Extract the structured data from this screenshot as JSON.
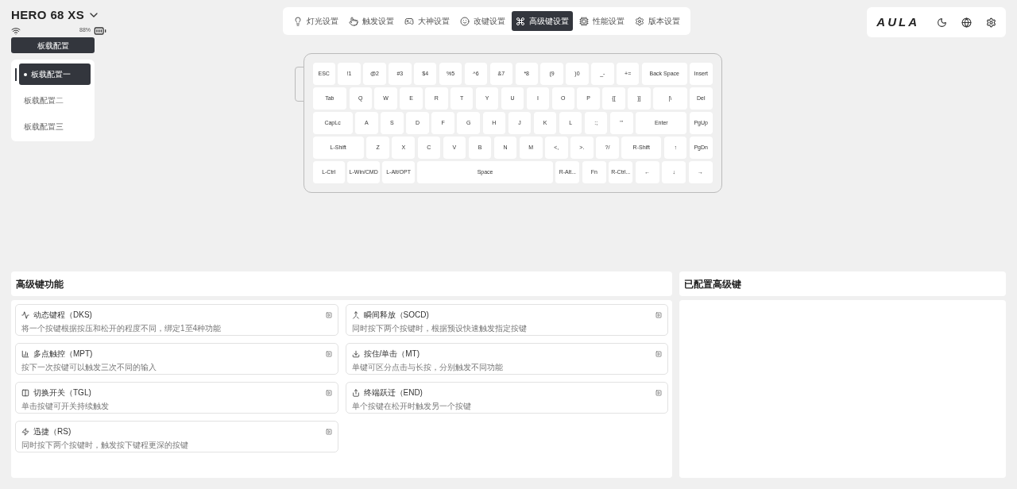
{
  "device": {
    "name": "HERO 68 XS",
    "battery": "88%"
  },
  "nav_tabs": [
    {
      "label": "灯光设置",
      "selected": false
    },
    {
      "label": "触发设置",
      "selected": false
    },
    {
      "label": "大神设置",
      "selected": false
    },
    {
      "label": "改键设置",
      "selected": false
    },
    {
      "label": "高级键设置",
      "selected": true
    },
    {
      "label": "性能设置",
      "selected": false
    },
    {
      "label": "版本设置",
      "selected": false
    }
  ],
  "brand": "AULA",
  "onboard": {
    "title": "板载配置",
    "profiles": [
      {
        "label": "板载配置一",
        "selected": true
      },
      {
        "label": "板载配置二",
        "selected": false
      },
      {
        "label": "板载配置三",
        "selected": false
      }
    ]
  },
  "keyboard": {
    "rows": [
      {
        "keys": [
          "ESC",
          "!1",
          "@2",
          "#3",
          "$4",
          "%5",
          "^6",
          "&7",
          "*8",
          "(9",
          ")0",
          "_-",
          "+=",
          "Back Space",
          "Insert"
        ]
      },
      {
        "keys": [
          "Tab",
          "Q",
          "W",
          "E",
          "R",
          "T",
          "Y",
          "U",
          "I",
          "O",
          "P",
          "{[",
          "}]",
          "|\\",
          "Del"
        ]
      },
      {
        "keys": [
          "CapLc",
          "A",
          "S",
          "D",
          "F",
          "G",
          "H",
          "J",
          "K",
          "L",
          ":;",
          "\"'",
          "Enter",
          "PgUp"
        ]
      },
      {
        "keys": [
          "L-Shift",
          "Z",
          "X",
          "C",
          "V",
          "B",
          "N",
          "M",
          "<,",
          ">.",
          "?/",
          "R-Shift",
          "↑",
          "PgDn"
        ]
      },
      {
        "keys": [
          "L-Ctrl",
          "L-Win/CMD",
          "L-Alt/OPT",
          "Space",
          "R-Alt...",
          "Fn",
          "R-Ctrl...",
          "←",
          "↓",
          "→"
        ]
      }
    ]
  },
  "advanced_functions": {
    "title": "高级键功能",
    "items": [
      {
        "title": "动态键程（DKS)",
        "description": "将一个按键根据按压和松开的程度不同，绑定1至4种功能"
      },
      {
        "title": "多点触控（MPT)",
        "description": "按下一次按键可以触发三次不同的输入"
      },
      {
        "title": "切换开关（TGL)",
        "description": "单击按键可开关持续触发"
      },
      {
        "title": "迅捷（RS)",
        "description": "同时按下两个按键时，触发按下键程更深的按键"
      },
      {
        "title": "瞬间释放（SOCD)",
        "description": "同时按下两个按键时，根据预设快速触发指定按键"
      },
      {
        "title": "按住/单击（MT)",
        "description": "单键可区分点击与长按，分别触发不同功能"
      },
      {
        "title": "终端跃迁（END)",
        "description": "单个按键在松开时触发另一个按键"
      }
    ]
  },
  "configured": {
    "title": "已配置高级键"
  }
}
